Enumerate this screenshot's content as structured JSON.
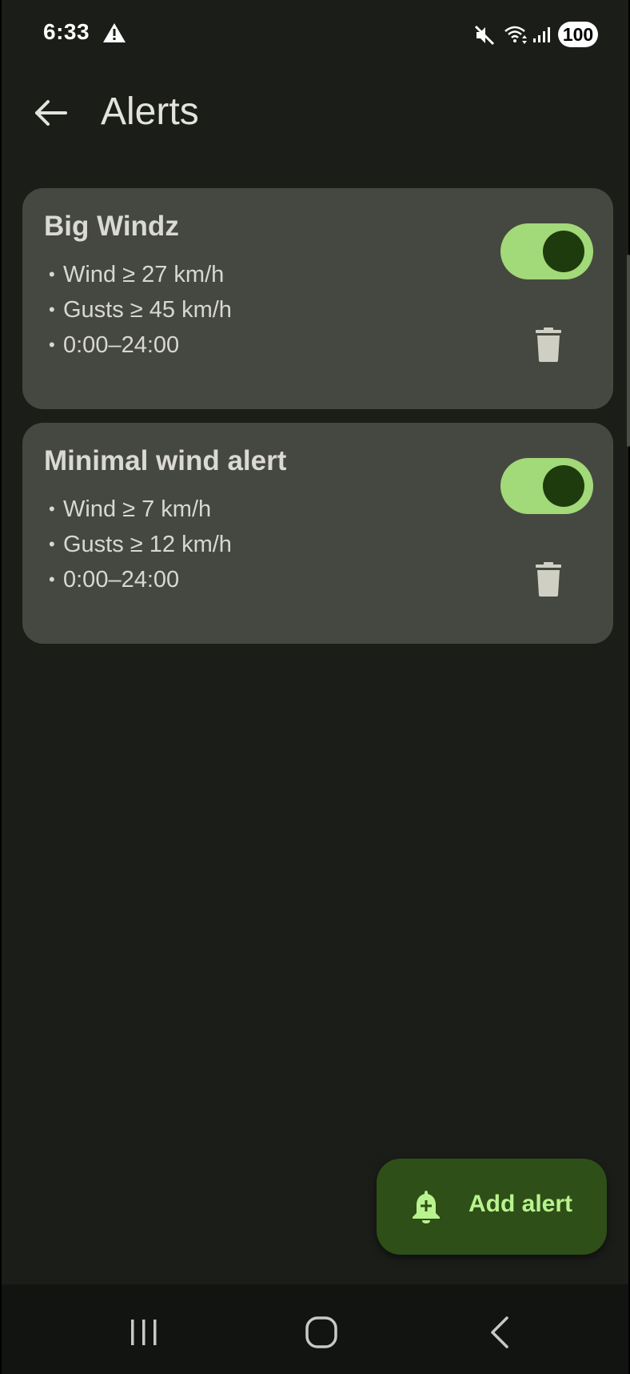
{
  "status_bar": {
    "time": "6:33",
    "battery": "100",
    "icons": [
      "warning-icon",
      "mute-icon",
      "wifi-icon",
      "signal-icon"
    ]
  },
  "app_bar": {
    "title": "Alerts",
    "back_icon": "arrow-back-icon"
  },
  "alerts": [
    {
      "name": "Big Windz",
      "details": [
        "Wind ≥ 27 km/h",
        "Gusts ≥ 45 km/h",
        "0:00–24:00"
      ],
      "enabled": true
    },
    {
      "name": "Minimal wind alert",
      "details": [
        "Wind ≥ 7 km/h",
        "Gusts ≥ 12 km/h",
        "0:00–24:00"
      ],
      "enabled": true
    }
  ],
  "bullet": "•",
  "fab": {
    "label": "Add alert",
    "icon": "add-alert-bell-icon"
  },
  "colors": {
    "background": "#1b1d19",
    "card": "#454840",
    "toggle_track": "#a2d979",
    "toggle_knob": "#1e3b0e",
    "fab_background": "#2e4f17",
    "fab_text": "#b9f38f"
  },
  "nav_bar": {
    "icons": [
      "recents-icon",
      "home-icon",
      "nav-back-icon"
    ]
  }
}
